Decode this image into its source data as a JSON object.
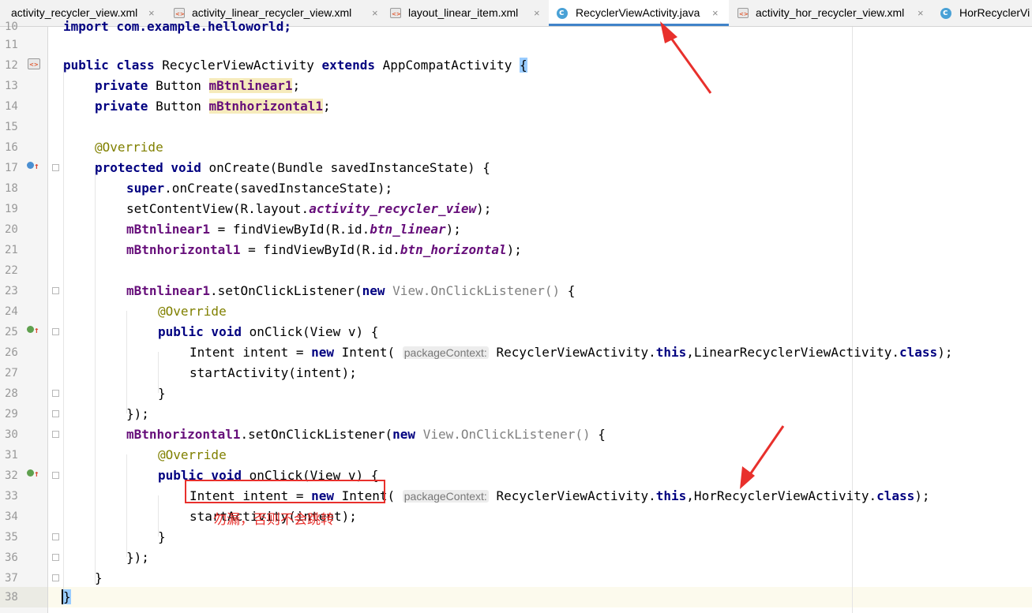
{
  "tabs": [
    {
      "label": "activity_recycler_view.xml",
      "type": "xml",
      "active": false,
      "close": "×"
    },
    {
      "label": "activity_linear_recycler_view.xml",
      "type": "xml",
      "active": false,
      "close": "×"
    },
    {
      "label": "layout_linear_item.xml",
      "type": "xml",
      "active": false,
      "close": "×"
    },
    {
      "label": "RecyclerViewActivity.java",
      "type": "class",
      "active": true,
      "close": "×"
    },
    {
      "label": "activity_hor_recycler_view.xml",
      "type": "xml",
      "active": false,
      "close": "×"
    },
    {
      "label": "HorRecyclerVi",
      "type": "class",
      "active": false,
      "close": ""
    }
  ],
  "editor": {
    "line_numbers": [
      "10",
      "11",
      "12",
      "13",
      "14",
      "15",
      "16",
      "17",
      "18",
      "19",
      "20",
      "21",
      "22",
      "23",
      "24",
      "25",
      "26",
      "27",
      "28",
      "29",
      "30",
      "31",
      "32",
      "33",
      "34",
      "35",
      "36",
      "37",
      "38"
    ],
    "lines": {
      "l10": "import com.example.helloworld;",
      "l12": {
        "kw1": "public class",
        "name": "RecyclerViewActivity",
        "kw2": "extends",
        "sup": "AppCompatActivity",
        "brace": "{"
      },
      "l13": {
        "kw": "private",
        "type": "Button",
        "field": "mBtnlinear1",
        "end": ";"
      },
      "l14": {
        "kw": "private",
        "type": "Button",
        "field": "mBtnhorizontal1",
        "end": ";"
      },
      "l16": "@Override",
      "l17": {
        "kw": "protected void",
        "rest": "onCreate(Bundle savedInstanceState) {"
      },
      "l18": {
        "kw": "super",
        "rest": ".onCreate(savedInstanceState);"
      },
      "l19": {
        "pre": "setContentView(R.layout.",
        "ital": "activity_recycler_view",
        "post": ");"
      },
      "l20": {
        "field": "mBtnlinear1",
        "pre": " = findViewById(R.id.",
        "ital": "btn_linear",
        "post": ");"
      },
      "l21": {
        "field": "mBtnhorizontal1",
        "pre": " = findViewById(R.id.",
        "ital": "btn_horizontal",
        "post": ");"
      },
      "l23": {
        "field": "mBtnlinear1",
        "pre": ".setOnClickListener(",
        "kw": "new",
        "gray": "View.OnClickListener()",
        "post": " {"
      },
      "l24": "@Override",
      "l25": {
        "kw": "public void",
        "rest": "onClick(View v) {"
      },
      "l26": {
        "pre": "Intent intent = ",
        "kw": "new",
        "mid": "Intent(",
        "hint": "packageContext:",
        "arg": "RecyclerViewActivity.",
        "kw2": "this",
        "arg2": ",LinearRecyclerViewActivity.",
        "kw3": "class",
        "post": ");"
      },
      "l27": "startActivity(intent);",
      "l28": "}",
      "l29": "});",
      "l30": {
        "field": "mBtnhorizontal1",
        "pre": ".setOnClickListener(",
        "kw": "new",
        "gray": "View.OnClickListener()",
        "post": " {"
      },
      "l31": "@Override",
      "l32": {
        "kw": "public void",
        "rest": "onClick(View v) {"
      },
      "l33": {
        "pre": "Intent intent = ",
        "kw": "new",
        "mid": "Intent(",
        "hint": "packageContext:",
        "arg": "RecyclerViewActivity.",
        "kw2": "this",
        "arg2": ",HorRecyclerViewActivity.",
        "kw3": "class",
        "post": ");"
      },
      "l34": "startActivity(intent);",
      "l35": "}",
      "l36": "});",
      "l37": "}",
      "l38": "}"
    }
  },
  "annotation": {
    "note": "勿漏，否则不会跳转",
    "color": "#e8302c"
  },
  "colors": {
    "keyword": "#000080",
    "field": "#660e7a",
    "annotation": "#808000",
    "line_number": "#999999",
    "tab_accent": "#4083c9"
  }
}
